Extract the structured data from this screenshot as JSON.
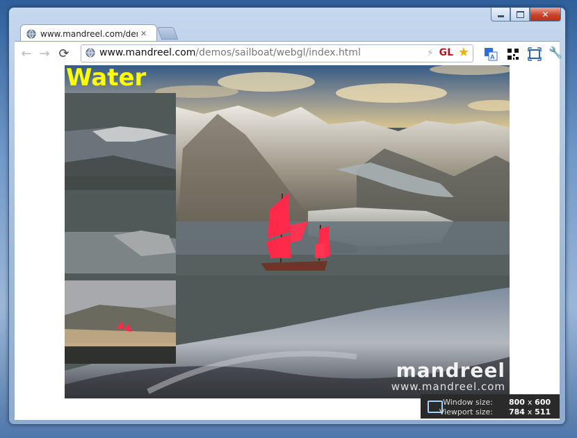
{
  "window": {
    "minimize_label": "",
    "close_label": "✕"
  },
  "tab": {
    "title": "www.mandreel.com/demos/sailboat/webgl/index.html",
    "close": "✕"
  },
  "toolbar": {
    "back": "←",
    "forward": "→",
    "reload": "⟳",
    "url_host": "www.mandreel.com",
    "url_path": "/demos/sailboat/webgl/index.html",
    "gl_badge": "GL",
    "star": "★",
    "bolt": "⚡",
    "wrench": "🔧"
  },
  "scene": {
    "title": "Water",
    "logo_big": "mandreel",
    "logo_url": "www.mandreel.com"
  },
  "sizeinfo": {
    "window_label": "Window size:",
    "window_w": "800",
    "window_h": "600",
    "viewport_label": "Viewport size:",
    "viewport_w": "784",
    "viewport_h": "511",
    "times": "x"
  },
  "icons": [
    "globe-icon",
    "back-arrow-icon",
    "forward-arrow-icon",
    "reload-icon",
    "bolt-icon",
    "star-icon",
    "translate-icon",
    "qr-code-icon",
    "fullscreen-icon",
    "wrench-icon",
    "window-size-icon"
  ]
}
